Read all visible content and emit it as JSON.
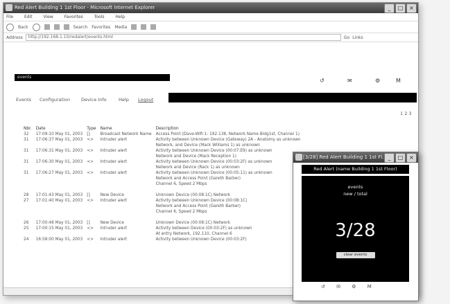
{
  "window": {
    "title": "Red Alert Building 1 1st Floor - Microsoft Internet Explorer",
    "buttons": [
      "_",
      "□",
      "×"
    ]
  },
  "menu": [
    "File",
    "Edit",
    "View",
    "Favorites",
    "Tools",
    "Help"
  ],
  "toolbar": {
    "back": "Back",
    "search": "Search",
    "favorites": "Favorites",
    "media": "Media"
  },
  "address": {
    "label": "Address",
    "url": "http://192.168.1.10/redalert/events.html",
    "go": "Go",
    "links": "Links"
  },
  "page": {
    "search_label": "events",
    "nav": [
      "Events",
      "Configuration",
      "Device Info",
      "Help",
      "Logout"
    ],
    "top_icons": [
      "↺",
      "✉",
      "⚙",
      "M"
    ],
    "pager": "1 2 3",
    "columns": [
      "Nbr.",
      "Date",
      "Type",
      "Name",
      "Description"
    ],
    "rows": [
      {
        "n": "32",
        "d": "17:09:10 May 01, 2003",
        "t": "[]",
        "name": "Broadcast Network Name",
        "desc": "Access Point (Dave-Wifi-1: 192.138, Network Name Bldg1st, Channel 1)"
      },
      {
        "n": "31",
        "d": "17:06:37 May 01, 2003",
        "t": "<>",
        "name": "Intruder alert",
        "desc": "Activity between Unknown Device (Gateway) 2A - Anatomy as unknown"
      },
      {
        "n": "",
        "d": "",
        "t": "",
        "name": "",
        "desc": "Network, and Device (Mack Williams 1) as unknown"
      },
      {
        "n": "31",
        "d": "17:06:31 May 01, 2003",
        "t": "<>",
        "name": "Intruder alert",
        "desc": "Activity between Unknown Device (00:07:E9) as unknown"
      },
      {
        "n": "",
        "d": "",
        "t": "",
        "name": "",
        "desc": "Network and Device (Mack Reception 1)"
      },
      {
        "n": "31",
        "d": "17:06:30 May 01, 2003",
        "t": "<>",
        "name": "Intruder alert",
        "desc": "Activity between Unknown Device (00:03:2F) as unknown"
      },
      {
        "n": "",
        "d": "",
        "t": "",
        "name": "",
        "desc": "Network and Device (Rack 1) as unknown"
      },
      {
        "n": "31",
        "d": "17:06:27 May 01, 2003",
        "t": "<>",
        "name": "Intruder alert",
        "desc": "Activity between Unknown Device (00:05:11) as unknown"
      },
      {
        "n": "",
        "d": "",
        "t": "",
        "name": "",
        "desc": "Network and Access Point (Gareth Barber)"
      },
      {
        "n": "",
        "d": "",
        "t": "",
        "name": "",
        "desc": "Channel 6, Speed 2 Mbps"
      },
      {
        "gap": true
      },
      {
        "n": "28",
        "d": "17:01:43 May 01, 2003",
        "t": "[]",
        "name": "New Device",
        "desc": "Unknown Device (00:08:1C) Network"
      },
      {
        "n": "27",
        "d": "17:01:40 May 01, 2003",
        "t": "<>",
        "name": "Intruder alert",
        "desc": "Activity between Unknown Device (00:08:1C)"
      },
      {
        "n": "",
        "d": "",
        "t": "",
        "name": "",
        "desc": "Network and Access Point (Gareth Barber)"
      },
      {
        "n": "",
        "d": "",
        "t": "",
        "name": "",
        "desc": "Channel 6, Speed 2 Mbps"
      },
      {
        "gap": true
      },
      {
        "n": "26",
        "d": "17:00:48 May 01, 2003",
        "t": "[]",
        "name": "New Device",
        "desc": "Unknown Device (00:08:1C) Network"
      },
      {
        "n": "25",
        "d": "17:00:15 May 01, 2003",
        "t": "<>",
        "name": "Intruder alert",
        "desc": "Activity between Device (00:03:2F) as unknown"
      },
      {
        "n": "",
        "d": "",
        "t": "",
        "name": "",
        "desc": "At entry Network, 192.110, Channel 6"
      },
      {
        "n": "24",
        "d": "16:58:00 May 01, 2003",
        "t": "<>",
        "name": "Intruder alert",
        "desc": "Activity between Unknown Device (00:03:2F)"
      }
    ]
  },
  "popup": {
    "title": "[3/28] Red Alert Building 1 1st Fl...",
    "banner": "Red Alert (name Building 1 1st Floor)",
    "line1": "events",
    "line2": "new / total",
    "count": "3/28",
    "button": "clear events",
    "footer_icons": [
      "↺",
      "✉",
      "⚙",
      "M"
    ]
  }
}
